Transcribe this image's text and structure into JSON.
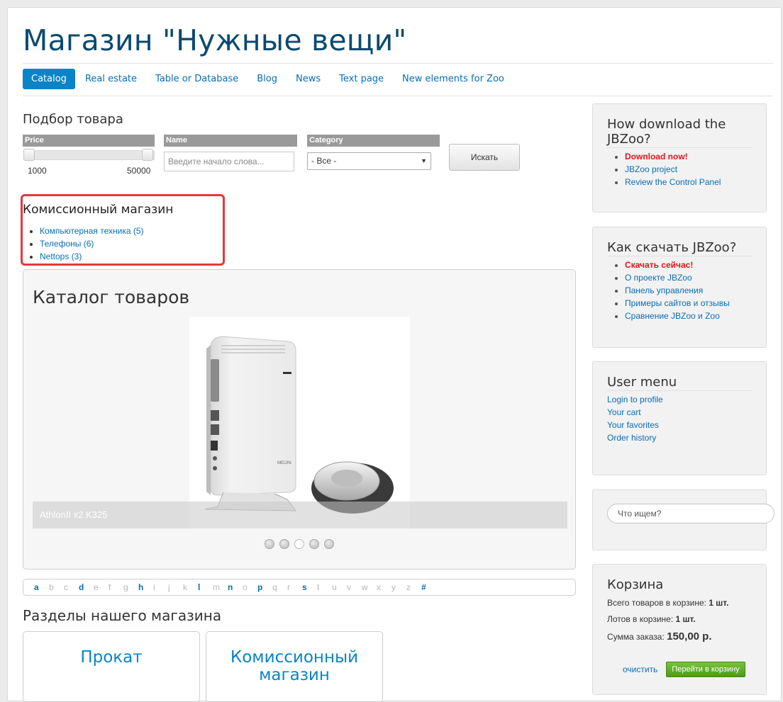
{
  "site": {
    "title": "Магазин \"Нужные вещи\""
  },
  "nav": [
    {
      "label": "Catalog",
      "active": true
    },
    {
      "label": "Real estate"
    },
    {
      "label": "Table or Database"
    },
    {
      "label": "Blog"
    },
    {
      "label": "News"
    },
    {
      "label": "Text page"
    },
    {
      "label": "New elements for Zoo"
    }
  ],
  "filter": {
    "title": "Подбор товара",
    "price_label": "Price",
    "price_min": "1000",
    "price_max": "50000",
    "name_label": "Name",
    "name_placeholder": "Введите начало слова...",
    "category_label": "Category",
    "category_value": "- Все -",
    "search_button": "Искать"
  },
  "shop": {
    "title": "Комиссионный магазин",
    "items": [
      "Компьютерная техника (5)",
      "Телефоны (6)",
      "Nettops (3)"
    ]
  },
  "catalog": {
    "title": "Каталог товаров",
    "slide_caption": "AthlonII x2 K325",
    "slide_brand": "MEIJIN",
    "slides_count": 5,
    "active_slide": 3
  },
  "alphabet": {
    "letters": [
      "a",
      "b",
      "c",
      "d",
      "e",
      "f",
      "g",
      "h",
      "i",
      "j",
      "k",
      "l",
      "m",
      "n",
      "o",
      "p",
      "q",
      "r",
      "s",
      "t",
      "u",
      "v",
      "w",
      "x",
      "y",
      "z",
      "#"
    ],
    "active": [
      "a",
      "d",
      "h",
      "l",
      "n",
      "p",
      "s",
      "#"
    ]
  },
  "sections": {
    "title": "Разделы нашего магазина",
    "cards": [
      "Прокат",
      "Комиссионный магазин"
    ]
  },
  "sidebar": {
    "download_en": {
      "title": "How download the JBZoo?",
      "items": [
        "Download now!",
        "JBZoo project",
        "Review the Control Panel"
      ]
    },
    "download_ru": {
      "title": "Как скачать JBZoo?",
      "items": [
        "Скачать сейчас!",
        "О проекте JBZoo",
        "Панель управления",
        "Примеры сайтов и отзывы",
        "Сравнение JBZoo и Zoo"
      ]
    },
    "user_menu": {
      "title": "User menu",
      "items": [
        "Login to profile",
        "Your cart",
        "Your favorites",
        "Order history"
      ]
    },
    "search": {
      "placeholder": "Что ищем?"
    },
    "cart": {
      "title": "Корзина",
      "total_items_label": "Всего товаров в корзине:",
      "total_items_value": "1 шт.",
      "lots_label": "Лотов в корзине:",
      "lots_value": "1 шт.",
      "sum_label": "Сумма заказа:",
      "sum_value": "150,00 р.",
      "clear_label": "очистить",
      "go_label": "Перейти в корзину"
    }
  },
  "colors": {
    "accent": "#0a84c7",
    "title": "#0b4a6e",
    "hot": "#e0161b",
    "highlight": "#e5383b",
    "go_button": "#5aa824"
  }
}
